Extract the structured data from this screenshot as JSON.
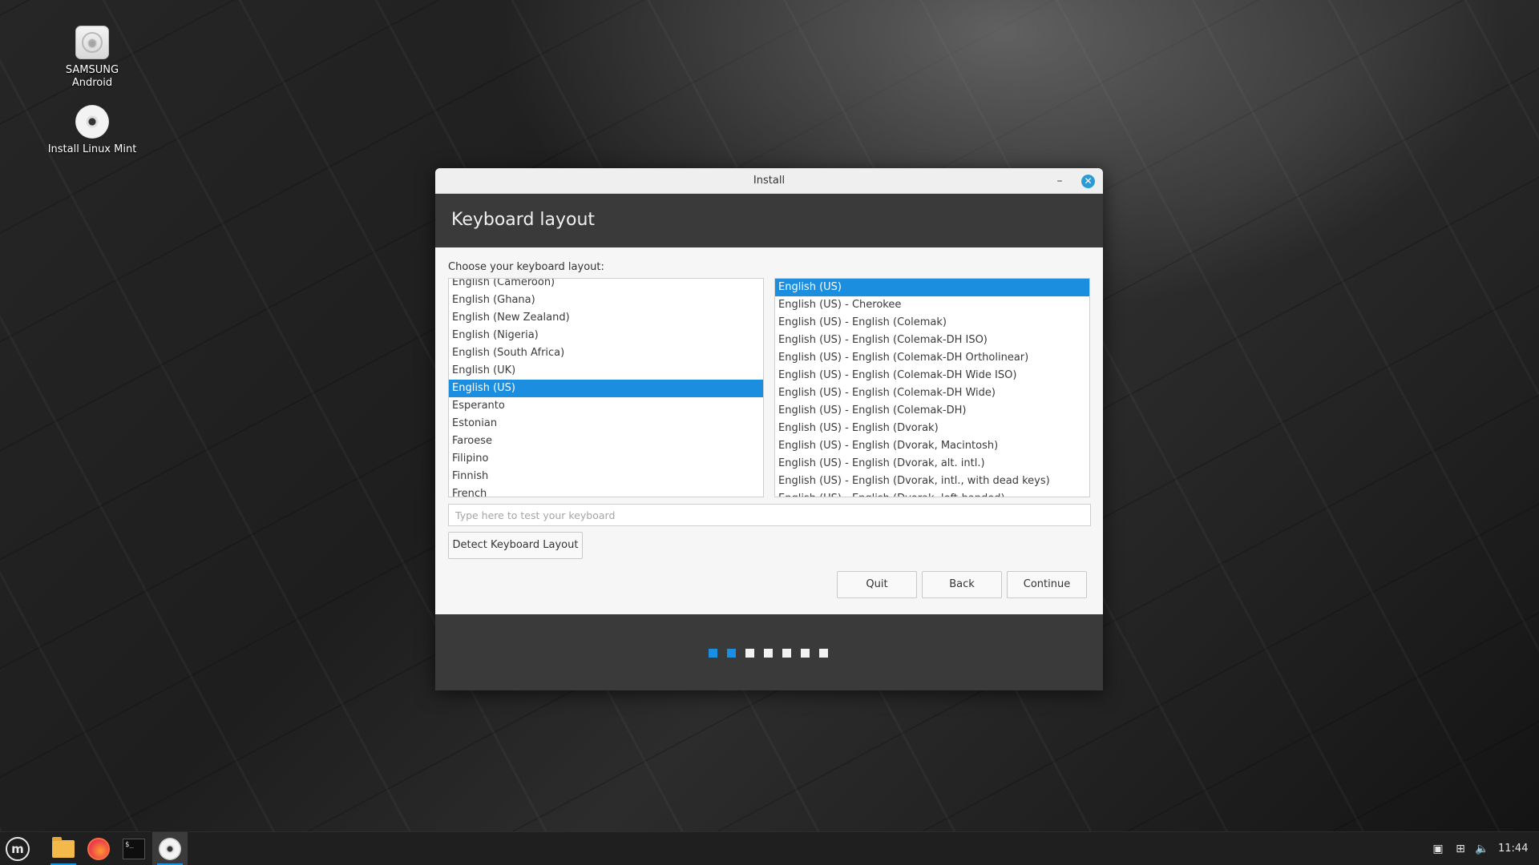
{
  "desktop": {
    "icons": [
      {
        "label_line1": "SAMSUNG",
        "label_line2": "Android",
        "icon": "phone-icon"
      },
      {
        "label": "Install Linux Mint",
        "icon": "disc-icon"
      }
    ]
  },
  "window": {
    "title": "Install",
    "header": "Keyboard layout",
    "choose_label": "Choose your keyboard layout:",
    "layouts": [
      {
        "label": "English (Cameroon)",
        "selected": false
      },
      {
        "label": "English (Ghana)",
        "selected": false
      },
      {
        "label": "English (New Zealand)",
        "selected": false
      },
      {
        "label": "English (Nigeria)",
        "selected": false
      },
      {
        "label": "English (South Africa)",
        "selected": false
      },
      {
        "label": "English (UK)",
        "selected": false
      },
      {
        "label": "English (US)",
        "selected": true
      },
      {
        "label": "Esperanto",
        "selected": false
      },
      {
        "label": "Estonian",
        "selected": false
      },
      {
        "label": "Faroese",
        "selected": false
      },
      {
        "label": "Filipino",
        "selected": false
      },
      {
        "label": "Finnish",
        "selected": false
      },
      {
        "label": "French",
        "selected": false
      }
    ],
    "variants": [
      {
        "label": "English (US)",
        "selected": true
      },
      {
        "label": "English (US) - Cherokee",
        "selected": false
      },
      {
        "label": "English (US) - English (Colemak)",
        "selected": false
      },
      {
        "label": "English (US) - English (Colemak-DH ISO)",
        "selected": false
      },
      {
        "label": "English (US) - English (Colemak-DH Ortholinear)",
        "selected": false
      },
      {
        "label": "English (US) - English (Colemak-DH Wide ISO)",
        "selected": false
      },
      {
        "label": "English (US) - English (Colemak-DH Wide)",
        "selected": false
      },
      {
        "label": "English (US) - English (Colemak-DH)",
        "selected": false
      },
      {
        "label": "English (US) - English (Dvorak)",
        "selected": false
      },
      {
        "label": "English (US) - English (Dvorak, Macintosh)",
        "selected": false
      },
      {
        "label": "English (US) - English (Dvorak, alt. intl.)",
        "selected": false
      },
      {
        "label": "English (US) - English (Dvorak, intl., with dead keys)",
        "selected": false
      },
      {
        "label": "English (US) - English (Dvorak, left-handed)",
        "selected": false
      }
    ],
    "test_input": {
      "value": "",
      "placeholder": "Type here to test your keyboard"
    },
    "detect_button": "Detect Keyboard Layout",
    "quit_button": "Quit",
    "back_button": "Back",
    "continue_button": "Continue",
    "progress": {
      "total_steps": 7,
      "completed_steps": 2
    }
  },
  "taskbar": {
    "clock": "11:44",
    "apps": [
      "menu-icon",
      "files-icon",
      "firefox-icon",
      "terminal-icon",
      "installer-icon"
    ]
  },
  "colors": {
    "accent": "#1c8ee0",
    "header_bg": "#3a3a3a",
    "taskbar_bg": "#1f1f1f"
  }
}
